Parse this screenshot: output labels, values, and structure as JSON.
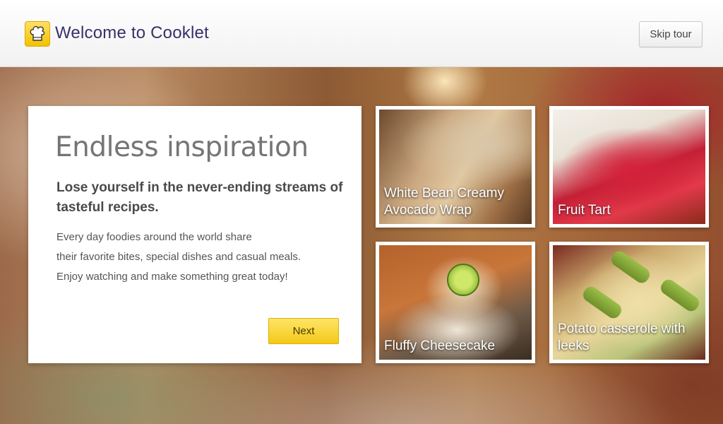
{
  "header": {
    "logo_icon": "chef-hat-icon",
    "title": "Welcome to Cooklet",
    "skip_label": "Skip tour"
  },
  "intro": {
    "heading": "Endless inspiration",
    "subheading": "Lose yourself in the never-ending streams of tasteful recipes.",
    "body_lines": [
      "Every day foodies around the world share",
      "their favorite bites, special dishes and casual meals.",
      "Enjoy watching and make something great today!"
    ],
    "next_label": "Next"
  },
  "recipes": [
    {
      "caption": "White Bean Creamy Avocado Wrap"
    },
    {
      "caption": "Fruit Tart"
    },
    {
      "caption": "Fluffy Cheesecake"
    },
    {
      "caption": "Potato casserole with leeks"
    }
  ],
  "colors": {
    "title": "#3a2f6b",
    "accent_yellow": "#f3c918",
    "heading_gray": "#757575"
  }
}
